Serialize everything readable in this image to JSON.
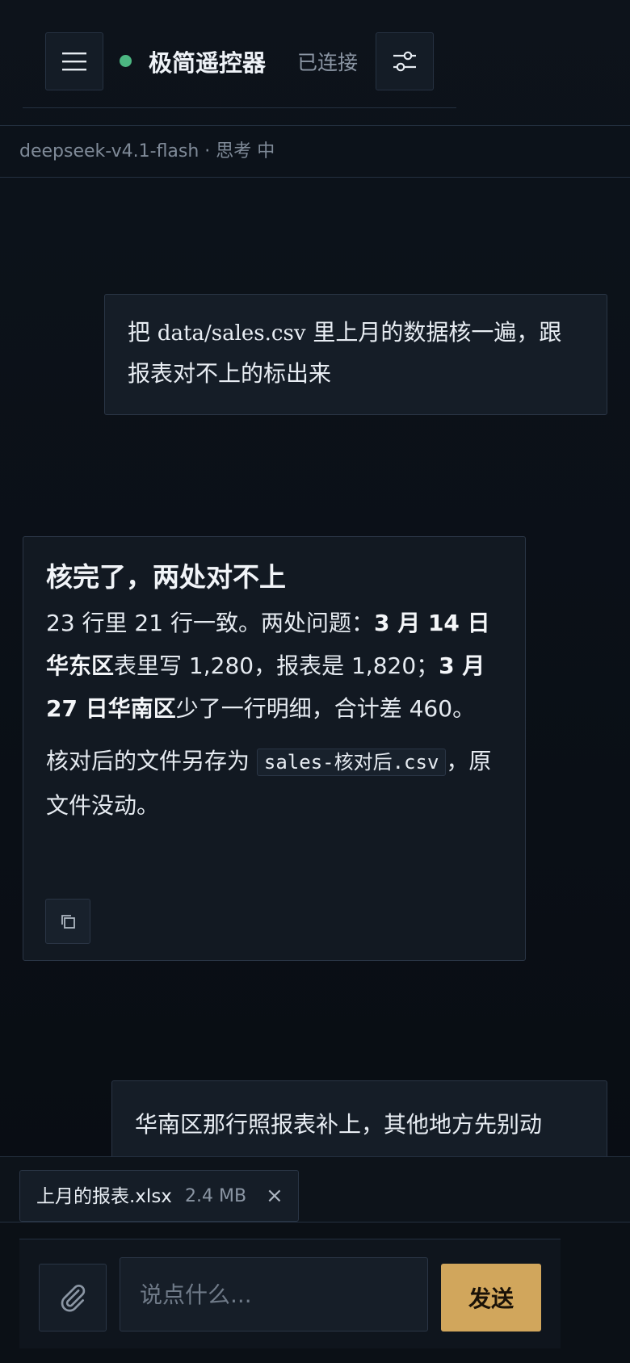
{
  "header": {
    "title": "极简遥控器",
    "status": "已连接",
    "status_color": "#4cb782",
    "menu_icon": "hamburger-menu-icon",
    "settings_icon": "sliders-icon"
  },
  "model_bar": {
    "text": "deepseek-v4.1-flash · 思考 中"
  },
  "messages": {
    "user_1": {
      "pre": "把 ",
      "path": "data/sales.csv",
      "post": " 里上月的数据核一遍，跟报表对不上的标出来"
    },
    "assistant": {
      "title": "核完了，两处对不上",
      "p1_a": "23 行里 21 行一致。两处问题：",
      "p1_b1": "3 月 14 日华东区",
      "p1_c": "表里写 1,280，报表是 1,820；",
      "p1_b2": "3 月 27 日华南区",
      "p1_d": "少了一行明细，合计差 460。",
      "p2_a": "核对后的文件另存为 ",
      "p2_code": "sales-核对后.csv",
      "p2_b": "，原文件没动。",
      "copy_icon": "copy-icon"
    },
    "user_2": {
      "text": "华南区那行照报表补上，其他地方先别动"
    }
  },
  "attachment": {
    "name": "上月的报表.xlsx",
    "size": "2.4 MB",
    "close": "×"
  },
  "composer": {
    "placeholder": "说点什么...",
    "send_label": "发送",
    "attach_icon": "paperclip-icon",
    "send_color": "#d1a65c"
  }
}
